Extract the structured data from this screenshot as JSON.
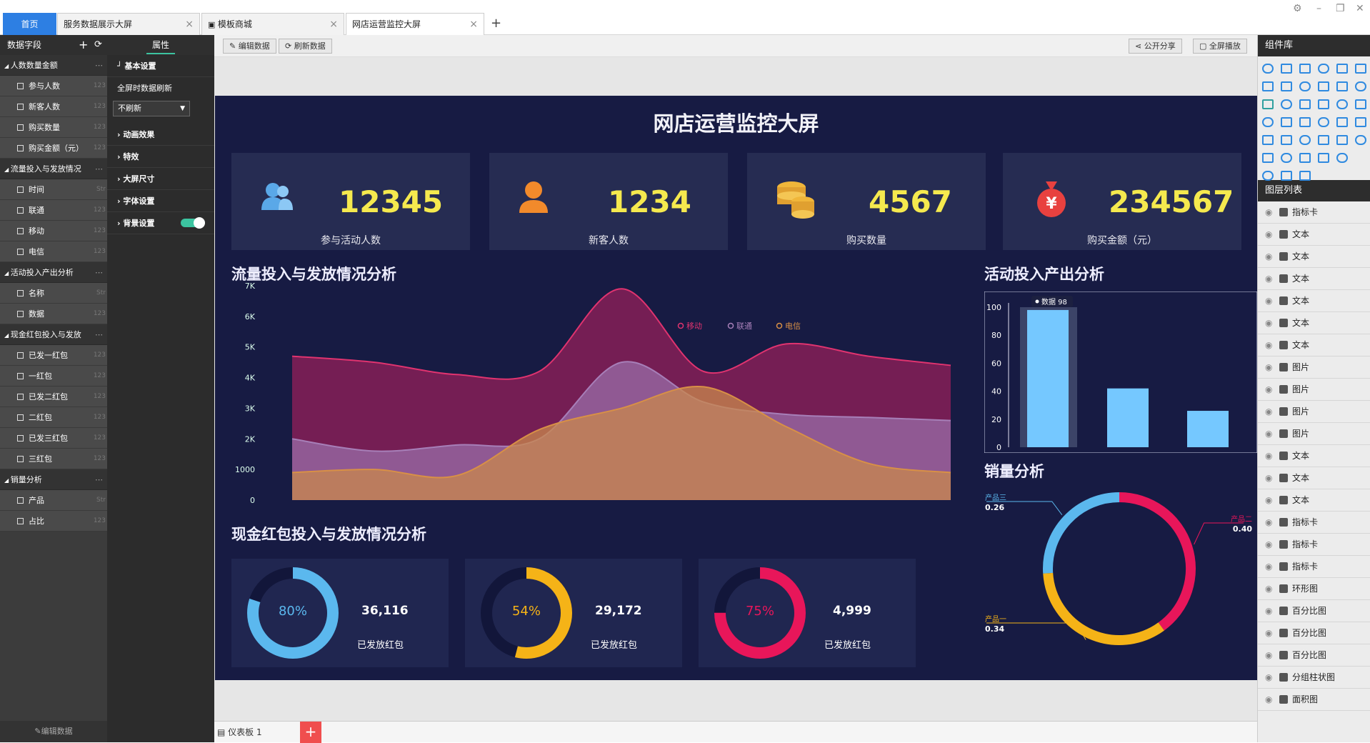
{
  "tabs": [
    {
      "label": "首页"
    },
    {
      "label": "服务数据展示大屏"
    },
    {
      "label": "模板商城"
    },
    {
      "label": "网店运营监控大屏"
    }
  ],
  "tab_add": "+",
  "left": {
    "title": "数据字段",
    "add": "+",
    "refresh": "⟳",
    "groups": [
      {
        "label": "人数数量金额",
        "fields": [
          {
            "label": "参与人数",
            "type": "123"
          },
          {
            "label": "新客人数",
            "type": "123"
          },
          {
            "label": "购买数量",
            "type": "123"
          },
          {
            "label": "购买金额（元）",
            "type": "123"
          }
        ]
      },
      {
        "label": "流量投入与发放情况",
        "fields": [
          {
            "label": "时间",
            "type": "Str"
          },
          {
            "label": "联通",
            "type": "123"
          },
          {
            "label": "移动",
            "type": "123"
          },
          {
            "label": "电信",
            "type": "123"
          }
        ]
      },
      {
        "label": "活动投入产出分析",
        "fields": [
          {
            "label": "名称",
            "type": "Str"
          },
          {
            "label": "数据",
            "type": "123"
          }
        ]
      },
      {
        "label": "现金红包投入与发放",
        "fields": [
          {
            "label": "已发一红包",
            "type": "123"
          },
          {
            "label": "一红包",
            "type": "123"
          },
          {
            "label": "已发二红包",
            "type": "123"
          },
          {
            "label": "二红包",
            "type": "123"
          },
          {
            "label": "已发三红包",
            "type": "123"
          },
          {
            "label": "三红包",
            "type": "123"
          }
        ]
      },
      {
        "label": "销量分析",
        "fields": [
          {
            "label": "产品",
            "type": "Str"
          },
          {
            "label": "占比",
            "type": "123"
          }
        ]
      }
    ],
    "footer": "编辑数据"
  },
  "props": {
    "tab": "属性",
    "basic": "基本设置",
    "refresh_label": "全屏时数据刷新",
    "refresh_value": "不刷新",
    "sections": [
      "动画效果",
      "特效",
      "大屏尺寸",
      "字体设置",
      "背景设置"
    ]
  },
  "toolbar": {
    "edit": "编辑数据",
    "refresh": "刷新数据",
    "share": "公开分享",
    "fullscreen": "全屏播放"
  },
  "screen": {
    "title": "网店运营监控大屏",
    "kpis": [
      {
        "value": "12345",
        "label": "参与活动人数",
        "icon": "users-icon",
        "color": "#5aa8e8"
      },
      {
        "value": "1234",
        "label": "新客人数",
        "icon": "user-icon",
        "color": "#f28a2b"
      },
      {
        "value": "4567",
        "label": "购买数量",
        "icon": "coins-icon",
        "color": "#f0b63a"
      },
      {
        "value": "234567",
        "label": "购买金额（元）",
        "icon": "money-bag-icon",
        "color": "#e8413f"
      }
    ],
    "area_title": "流量投入与发放情况分析",
    "bar_title": "活动投入产出分析",
    "rings_title": "现金红包投入与发放情况分析",
    "pie_title": "销量分析",
    "rings": [
      {
        "pct": "80%",
        "value": "36,116",
        "label": "已发放红包",
        "fraction": 0.8,
        "color": "#5bb8ee"
      },
      {
        "pct": "54%",
        "value": "29,172",
        "label": "已发放红包",
        "fraction": 0.54,
        "color": "#f5b317"
      },
      {
        "pct": "75%",
        "value": "4,999",
        "label": "已发放红包",
        "fraction": 0.75,
        "color": "#e8165a"
      }
    ]
  },
  "chart_data": [
    {
      "type": "area",
      "title": "流量投入与发放情况分析",
      "ylim": [
        0,
        7000
      ],
      "yticks": [
        "0",
        "1000",
        "2K",
        "3K",
        "4K",
        "5K",
        "6K",
        "7K"
      ],
      "legend_position": "top-right",
      "series": [
        {
          "name": "移动",
          "color": "#e0336f",
          "values": [
            4700,
            4500,
            4100,
            4200,
            6900,
            4200,
            5100,
            4700,
            4400
          ]
        },
        {
          "name": "联通",
          "color": "#a77fb8",
          "values": [
            2000,
            1600,
            1800,
            2000,
            4500,
            3200,
            2800,
            2700,
            2600
          ]
        },
        {
          "name": "电信",
          "color": "#d89046",
          "values": [
            900,
            1000,
            800,
            2300,
            3000,
            3700,
            2400,
            1200,
            900
          ]
        }
      ]
    },
    {
      "type": "bar",
      "title": "活动投入产出分析",
      "ylim": [
        0,
        100
      ],
      "yticks": [
        "0",
        "20",
        "40",
        "60",
        "80",
        "100"
      ],
      "values": [
        98,
        42,
        26
      ],
      "tooltip": "数据 98",
      "color": "#75c8ff"
    },
    {
      "type": "pie",
      "title": "销量分析",
      "slices": [
        {
          "name": "产品三",
          "value": "0.26",
          "color": "#5bb8ee"
        },
        {
          "name": "产品二",
          "value": "0.40",
          "color": "#e8165a"
        },
        {
          "name": "产品一",
          "value": "0.34",
          "color": "#f5b317"
        }
      ]
    }
  ],
  "right": {
    "components_title": "组件库",
    "layers_title": "图层列表",
    "layers": [
      {
        "label": "指标卡"
      },
      {
        "label": "文本"
      },
      {
        "label": "文本"
      },
      {
        "label": "文本"
      },
      {
        "label": "文本"
      },
      {
        "label": "文本"
      },
      {
        "label": "文本"
      },
      {
        "label": "图片"
      },
      {
        "label": "图片"
      },
      {
        "label": "图片"
      },
      {
        "label": "图片"
      },
      {
        "label": "文本"
      },
      {
        "label": "文本"
      },
      {
        "label": "文本"
      },
      {
        "label": "指标卡"
      },
      {
        "label": "指标卡"
      },
      {
        "label": "指标卡"
      },
      {
        "label": "环形图"
      },
      {
        "label": "百分比图"
      },
      {
        "label": "百分比图"
      },
      {
        "label": "百分比图"
      },
      {
        "label": "分组柱状图"
      },
      {
        "label": "面积图"
      }
    ]
  },
  "bottom": {
    "dashboard": "仪表板 1",
    "add": "+"
  }
}
